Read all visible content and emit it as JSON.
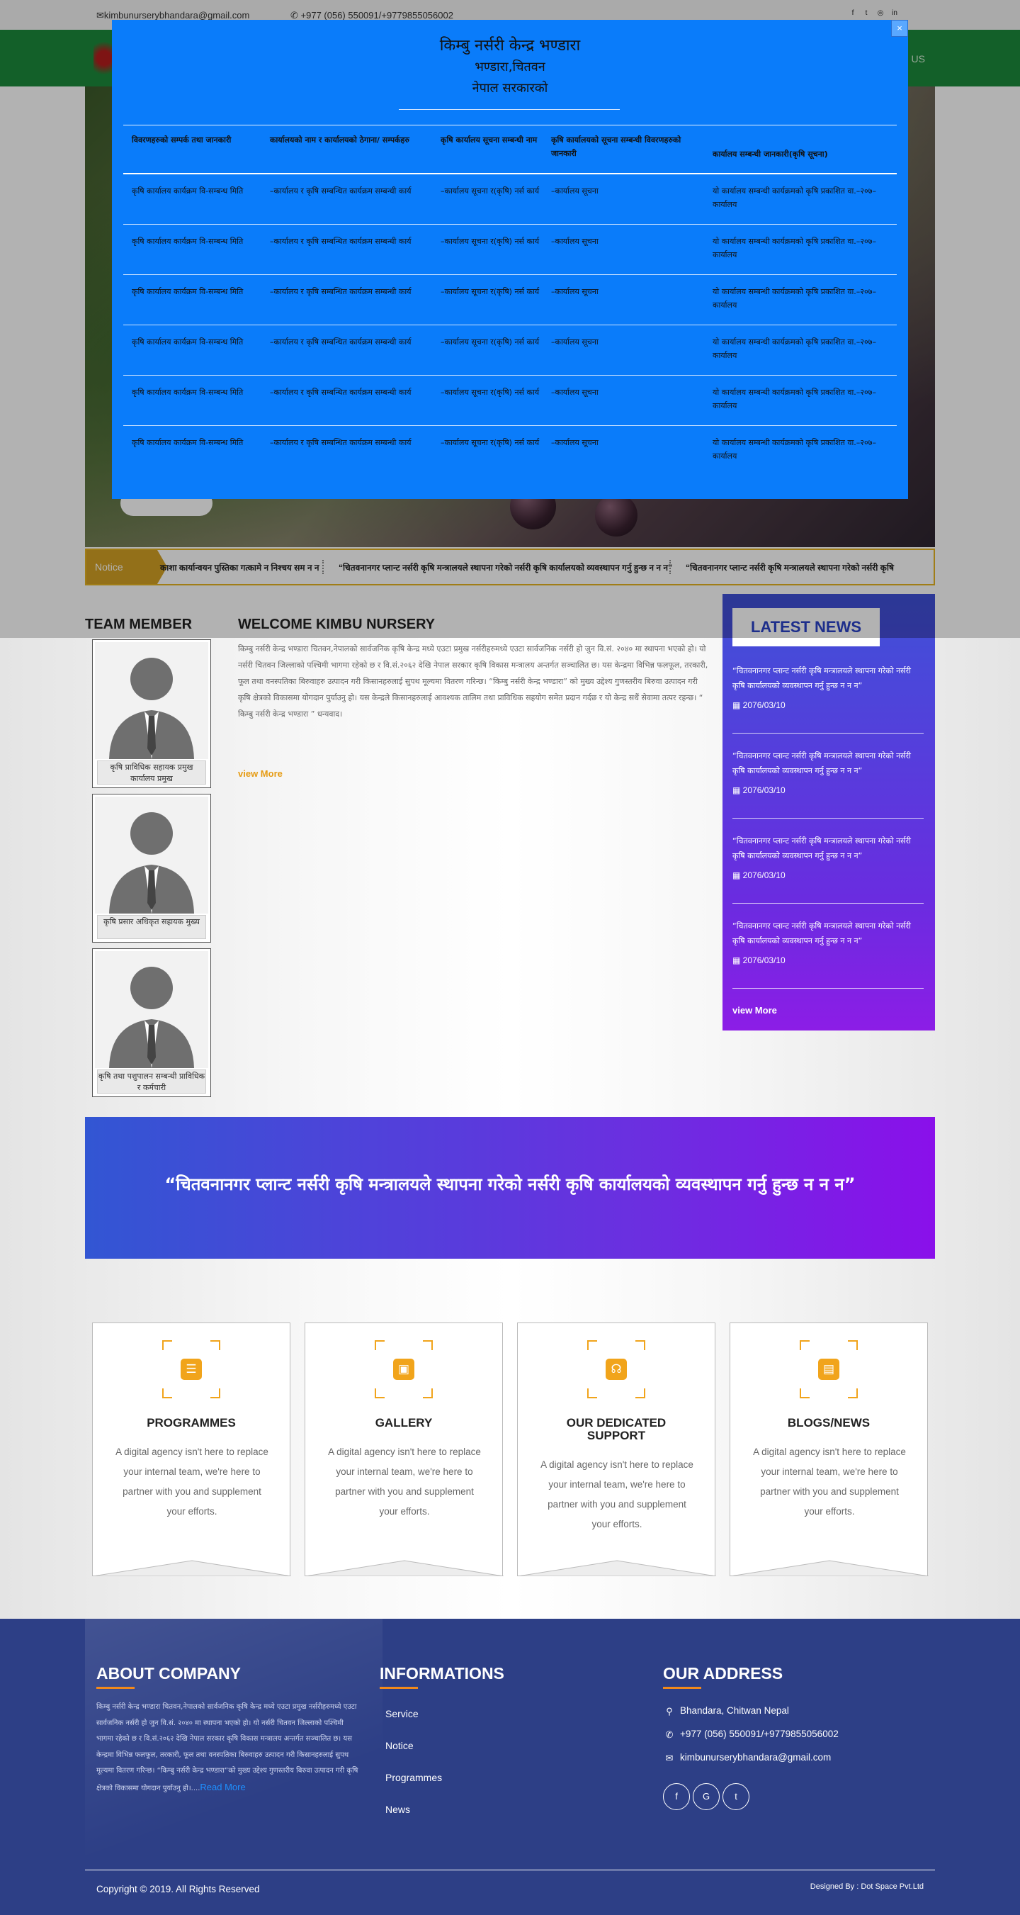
{
  "topbar": {
    "email": "kimbunurserybhandara@gmail.com",
    "phone": "+977 (056) 550091/+9779855056002",
    "social": [
      "f",
      "t",
      "◎",
      "in"
    ]
  },
  "nav": {
    "link_partial": "US"
  },
  "ticker": {
    "label": "Notice",
    "items": [
      "काशा कार्यान्वयन पुस्तिका गत्कामे न निश्चय सम न न",
      "“चितवनानगर प्लान्ट नर्सरी कृषि मन्त्रालयले स्थापना गरेको नर्सरी कृषि कार्यालयको व्यवस्थापन गर्नु हुन्छ न न न”",
      "“चितवनानगर प्लान्ट नर्सरी कृषि मन्त्रालयले स्थापना गरेको नर्सरी कृषि"
    ]
  },
  "modal": {
    "close": "×",
    "title": "किम्बु नर्सरी केन्द्र भण्डारा",
    "subtitle": "भण्डारा,चितवन",
    "subtitle2": "नेपाल सरकारको",
    "headers": [
      "विवरणहरुको सम्पर्क तथा जानकारी",
      "कार्यालयको नाम र कार्यालयको ठेगाना/ सम्पर्कहरु",
      "कृषि कार्यालय सूचना सम्बन्धी नाम",
      "कृषि कार्यालयको सूचना सम्बन्धी विवरणहरुको जानकारी",
      "कार्यालय सम्बन्धी जानकारी(कृषि सूचना)"
    ],
    "rows": [
      [
        "कृषि कार्यालय कार्यक्रम वि-सम्बन्ध मिति",
        "–कार्यालय र कृषि सम्बन्धित कार्यक्रम सम्बन्धी कार्य",
        "–कार्यालय सूचना र(कृषि) नर्स कार्य",
        "–कार्यालय सूचना",
        "यो कार्यालय सम्बन्धी कार्यक्रमको कृषि प्रकाशित वा.–२०७–कार्यालय"
      ],
      [
        "कृषि कार्यालय कार्यक्रम वि-सम्बन्ध मिति",
        "–कार्यालय र कृषि सम्बन्धित कार्यक्रम सम्बन्धी कार्य",
        "–कार्यालय सूचना र(कृषि) नर्स कार्य",
        "–कार्यालय सूचना",
        "यो कार्यालय सम्बन्धी कार्यक्रमको कृषि प्रकाशित वा.–२०७–कार्यालय"
      ],
      [
        "कृषि कार्यालय कार्यक्रम वि-सम्बन्ध मिति",
        "–कार्यालय र कृषि सम्बन्धित कार्यक्रम सम्बन्धी कार्य",
        "–कार्यालय सूचना र(कृषि) नर्स कार्य",
        "–कार्यालय सूचना",
        "यो कार्यालय सम्बन्धी कार्यक्रमको कृषि प्रकाशित वा.–२०७–कार्यालय"
      ],
      [
        "कृषि कार्यालय कार्यक्रम वि-सम्बन्ध मिति",
        "–कार्यालय र कृषि सम्बन्धित कार्यक्रम सम्बन्धी कार्य",
        "–कार्यालय सूचना र(कृषि) नर्स कार्य",
        "–कार्यालय सूचना",
        "यो कार्यालय सम्बन्धी कार्यक्रमको कृषि प्रकाशित वा.–२०७–कार्यालय"
      ],
      [
        "कृषि कार्यालय कार्यक्रम वि-सम्बन्ध मिति",
        "–कार्यालय र कृषि सम्बन्धित कार्यक्रम सम्बन्धी कार्य",
        "–कार्यालय सूचना र(कृषि) नर्स कार्य",
        "–कार्यालय सूचना",
        "यो कार्यालय सम्बन्धी कार्यक्रमको कृषि प्रकाशित वा.–२०७–कार्यालय"
      ],
      [
        "कृषि कार्यालय कार्यक्रम वि-सम्बन्ध मिति",
        "–कार्यालय र कृषि सम्बन्धित कार्यक्रम सम्बन्धी कार्य",
        "–कार्यालय सूचना र(कृषि) नर्स कार्य",
        "–कार्यालय सूचना",
        "यो कार्यालय सम्बन्धी कार्यक्रमको कृषि प्रकाशित वा.–२०७–कार्यालय"
      ]
    ]
  },
  "team": {
    "title": "TEAM MEMBER",
    "members": [
      "कृषि प्राविधिक सहायक प्रमुख कार्यालय प्रमुख",
      "कृषि प्रसार अधिकृत सहायक मुख्य",
      "कृषि तथा पशुपालन सम्बन्धी प्राविधिक र कर्मचारी"
    ]
  },
  "welcome": {
    "title": "WELCOME KIMBU NURSERY",
    "body": "किम्बु नर्सरी केन्द्र भण्डारा चितवन,नेपालको सार्वजनिक कृषि केन्द्र मध्ये एउटा प्रमुख नर्सरीहरुमध्ये एउटा सार्वजनिक नर्सरी हो जुन वि.सं. २०४० मा स्थापना भएको हो। यो नर्सरी चितवन जिल्लाको पश्चिमी भागमा रहेको छ र वि.सं.२०६२ देखि नेपाल सरकार कृषि विकास मन्त्रालय अन्तर्गत सञ्चालित छ। यस केन्द्रमा विभिन्न फलफूल, तरकारी, फूल तथा वनस्पतिका बिरुवाहरु उत्पादन गरी किसानहरुलाई सुपथ मूल्यमा वितरण गरिन्छ। “किम्बु नर्सरी केन्द्र भण्डारा” को मुख्य उद्देश्य गुणस्तरीय बिरुवा उत्पादन गरी कृषि क्षेत्रको विकासमा योगदान पुर्याउनु हो। यस केन्द्रले किसानहरुलाई आवश्यक तालिम तथा प्राविधिक सहयोग समेत प्रदान गर्दछ र यो केन्द्र सधैं सेवामा तत्पर रहन्छ। “ किम्बु नर्सरी केन्द्र भण्डारा ” धन्यवाद।",
    "view_more": "view More"
  },
  "news": {
    "title": "LATEST NEWS",
    "items": [
      {
        "text": "“चितवनानगर प्लान्ट नर्सरी कृषि मन्त्रालयले स्थापना गरेको नर्सरी कृषि कार्यालयको व्यवस्थापन गर्नु हुन्छ न न न”",
        "date": "2076/03/10"
      },
      {
        "text": "“चितवनानगर प्लान्ट नर्सरी कृषि मन्त्रालयले स्थापना गरेको नर्सरी कृषि कार्यालयको व्यवस्थापन गर्नु हुन्छ न न न”",
        "date": "2076/03/10"
      },
      {
        "text": "“चितवनानगर प्लान्ट नर्सरी कृषि मन्त्रालयले स्थापना गरेको नर्सरी कृषि कार्यालयको व्यवस्थापन गर्नु हुन्छ न न न”",
        "date": "2076/03/10"
      },
      {
        "text": "“चितवनानगर प्लान्ट नर्सरी कृषि मन्त्रालयले स्थापना गरेको नर्सरी कृषि कार्यालयको व्यवस्थापन गर्नु हुन्छ न न न”",
        "date": "2076/03/10"
      }
    ],
    "view_more": "view More"
  },
  "quote": "“चितवनानगर प्लान्ट नर्सरी कृषि मन्त्रालयले स्थापना गरेको नर्सरी कृषि कार्यालयको व्यवस्थापन गर्नु हुन्छ न न न”",
  "cards": [
    {
      "icon": "clipboard-icon",
      "glyph": "☰",
      "title": "PROGRAMMES",
      "desc": "A digital agency isn't here to replace your internal team, we're here to partner with you and supplement your efforts."
    },
    {
      "icon": "image-icon",
      "glyph": "▣",
      "title": "GALLERY",
      "desc": "A digital agency isn't here to replace your internal team, we're here to partner with you and supplement your efforts."
    },
    {
      "icon": "headset-icon",
      "glyph": "☊",
      "title": "OUR DEDICATED SUPPORT",
      "desc": "A digital agency isn't here to replace your internal team, we're here to partner with you and supplement your efforts."
    },
    {
      "icon": "blog-icon",
      "glyph": "▤",
      "title": "BLOGS/NEWS",
      "desc": "A digital agency isn't here to replace your internal team, we're here to partner with you and supplement your efforts."
    }
  ],
  "footer": {
    "about_title": "ABOUT COMPANY",
    "about_text": "किम्बु नर्सरी केन्द्र भण्डारा चितवन,नेपालको सार्वजनिक कृषि केन्द्र मध्ये एउटा प्रमुख नर्सरीहरुमध्ये एउटा सार्वजनिक नर्सरी हो जुन वि.सं. २०४० मा स्थापना भएको हो। यो नर्सरी चितवन जिल्लाको पश्चिमी भागमा रहेको छ र वि.सं.२०६२ देखि नेपाल सरकार कृषि विकास मन्त्रालय अन्तर्गत सञ्चालित छ। यस केन्द्रमा विभिन्न फलफूल, तरकारी, फूल तथा वनस्पतिका बिरुवाहरु उत्पादन गरी किसानहरुलाई सुपथ मूल्यमा वितरण गरिन्छ। “किम्बु नर्सरी केन्द्र भण्डारा”को मुख्य उद्देश्य गुणस्तरीय बिरुवा उत्पादन गरी कृषि क्षेत्रको विकासमा योगदान पुर्याउनु हो।....",
    "read_more": "Read More",
    "info_title": "INFORMATIONS",
    "links": [
      "Service",
      "Notice",
      "Programmes",
      "News"
    ],
    "address_title": "OUR ADDRESS",
    "address": "Bhandara, Chitwan Nepal",
    "phone": "+977 (056) 550091/+9779855056002",
    "email": "kimbunurserybhandara@gmail.com",
    "social": [
      "f",
      "G",
      "t"
    ],
    "copyright": "Copyright © 2019. All Rights Reserved",
    "designed_by": "Designed By : Dot Space Pvt.Ltd"
  }
}
